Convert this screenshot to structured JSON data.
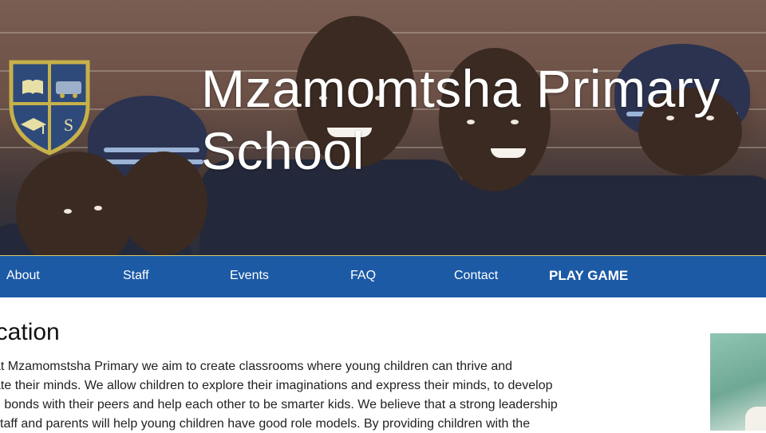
{
  "header": {
    "title": "Mzamomtsha Primary School",
    "logo_icon": "school-crest-icon",
    "logo_colors": {
      "shield": "#2e4a7a",
      "border": "#c7b14a"
    },
    "logo_letter": "S"
  },
  "nav": {
    "items": [
      {
        "label": "About"
      },
      {
        "label": "Staff"
      },
      {
        "label": "Events"
      },
      {
        "label": "FAQ"
      },
      {
        "label": "Contact"
      },
      {
        "label": "PLAY GAME"
      }
    ],
    "background": "#1c5aa6"
  },
  "content": {
    "heading": "ucation",
    "paragraph_lines": [
      "at Mzamomstsha Primary we aim to create classrooms where young children can thrive and",
      "ate their minds. We allow children to explore their imaginations and express their minds, to develop",
      "g bonds with their peers and help each other to be smarter kids. We believe that a strong leadership",
      "staff and parents will help young children have good role models. By providing children with the"
    ]
  }
}
